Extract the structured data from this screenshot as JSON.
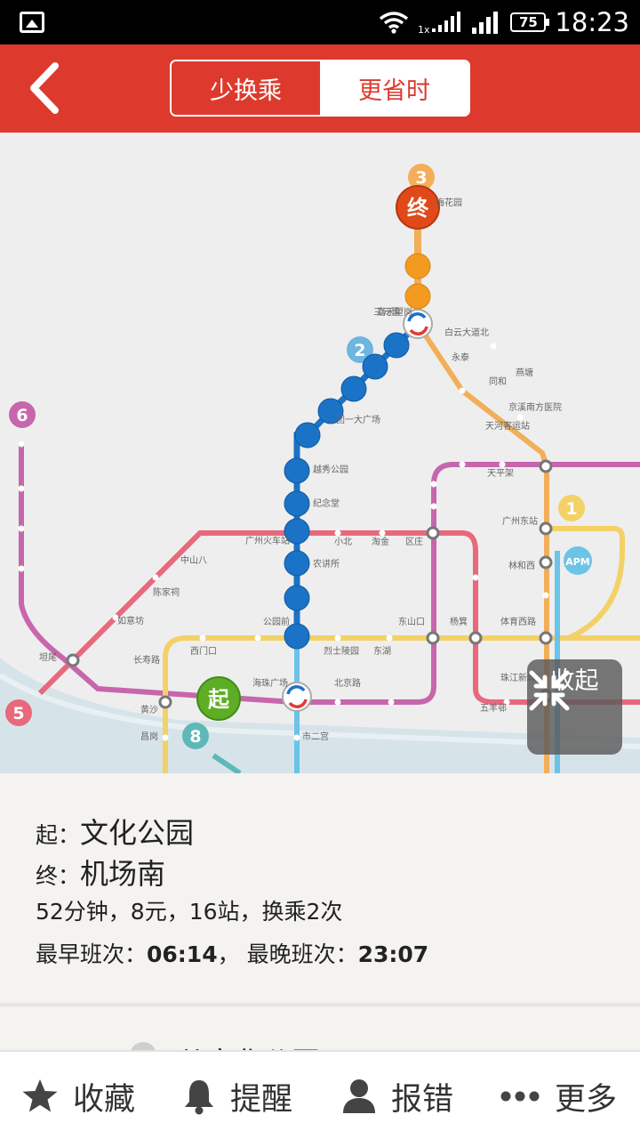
{
  "status_bar": {
    "time": "18:23",
    "battery": "75",
    "icons": [
      "image-icon",
      "wifi-icon",
      "signal-1x-icon",
      "signal-icon",
      "battery-icon"
    ],
    "network_label": "1x"
  },
  "header": {
    "tabs": [
      {
        "label": "少换乘",
        "active": true
      },
      {
        "label": "更省时",
        "active": false
      }
    ],
    "accent": "#dd3a2d"
  },
  "map": {
    "line_badges": [
      "3",
      "2",
      "6",
      "1",
      "5",
      "8"
    ],
    "apm_label": "APM",
    "start_marker": "起",
    "end_marker": "终",
    "collapse_label": "收起",
    "station_labels": [
      "广州火车站",
      "公园前",
      "东山口",
      "杨箕",
      "体育西路",
      "海珠广场",
      "北京路",
      "广州东站",
      "林和西",
      "天河客运站",
      "珠江新城",
      "五羊邨",
      "三元里",
      "越秀公园",
      "纪念堂",
      "团一大广场",
      "农讲所",
      "烈士陵园",
      "东湖",
      "小北",
      "淘金",
      "区庄",
      "中山八",
      "坦尾",
      "如意坊",
      "黄沙",
      "长寿路",
      "陈家祠",
      "西门口",
      "昌岗",
      "市二宫",
      "燕塘",
      "天平架",
      "嘉禾望岗",
      "白云大道北",
      "永泰",
      "同和",
      "京溪南方医院",
      "梅花园"
    ]
  },
  "info": {
    "start_label": "起：",
    "start_name": "文化公园",
    "end_label": "终：",
    "end_name": "机场南",
    "summary": "52分钟，8元，16站，换乘2次",
    "earliest_label": "最早班次：",
    "earliest_time": "06:14",
    "separator": "，",
    "latest_label": "最晚班次：",
    "latest_time": "23:07",
    "partial_text": "从文化公园"
  },
  "toolbar": {
    "items": [
      {
        "label": "收藏",
        "icon": "star-icon"
      },
      {
        "label": "提醒",
        "icon": "bell-icon"
      },
      {
        "label": "报错",
        "icon": "user-icon"
      },
      {
        "label": "更多",
        "icon": "more-icon"
      }
    ]
  },
  "colors": {
    "line1": "#f3d166",
    "line2": "#1a73c6",
    "line3": "#f2ae59",
    "line5": "#e8687c",
    "line6": "#c766ad",
    "line8": "#5fb8b8",
    "apm": "#6cc3e8",
    "route": "#1a73c6"
  }
}
